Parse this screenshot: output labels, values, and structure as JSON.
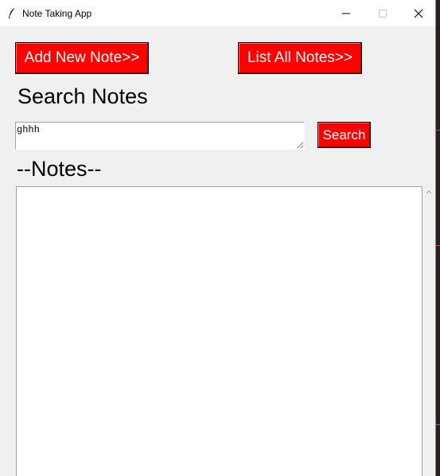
{
  "window": {
    "title": "Note Taking App",
    "icon": "feather-icon"
  },
  "controls": {
    "minimize_icon": "minimize-icon",
    "maximize_icon": "maximize-icon",
    "close_icon": "close-icon"
  },
  "buttons": {
    "add_note": "Add New Note>>",
    "list_notes": "List All Notes>>",
    "search": "Search",
    "color": "#ff0000",
    "text_color": "#ffffff"
  },
  "search": {
    "heading": "Search Notes",
    "value": "ghhh"
  },
  "notes": {
    "heading": "--Notes--",
    "content": ""
  }
}
